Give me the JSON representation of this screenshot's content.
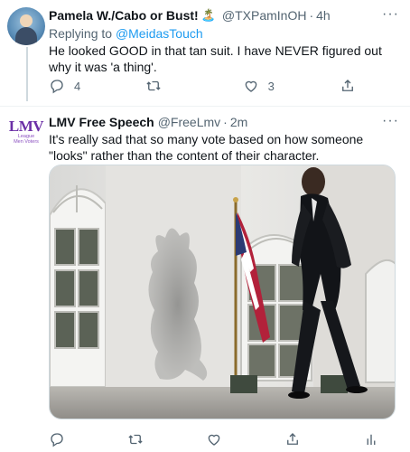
{
  "tweets": [
    {
      "name": "Pamela W./Cabo or Bust!",
      "emoji": "🏝️",
      "handle": "@TXPamInOH",
      "separator": "·",
      "time": "4h",
      "more": "···",
      "reply_prefix": "Replying to ",
      "reply_to": "@MeidasTouch",
      "text": "He looked GOOD in that tan suit. I have NEVER figured out why it was 'a thing'.",
      "reply_count": "4",
      "retweet_count": "",
      "like_count": "3"
    },
    {
      "name": "LMV Free Speech",
      "handle": "@FreeLmv",
      "separator": "·",
      "time": "2m",
      "more": "···",
      "avatar_logo": "LMV",
      "avatar_small_1": "League",
      "avatar_small_2": "Men Voters",
      "text": "It's really sad that so many vote based on how someone \"looks\" rather than the content of their character.",
      "reply_count": "",
      "retweet_count": "",
      "like_count": ""
    }
  ],
  "icons": [
    "reply-icon",
    "retweet-icon",
    "like-icon",
    "share-icon",
    "analytics-icon"
  ],
  "colors": {
    "link": "#1d9bf0",
    "secondary": "#536471",
    "logo_purple": "#6b2fa6"
  }
}
